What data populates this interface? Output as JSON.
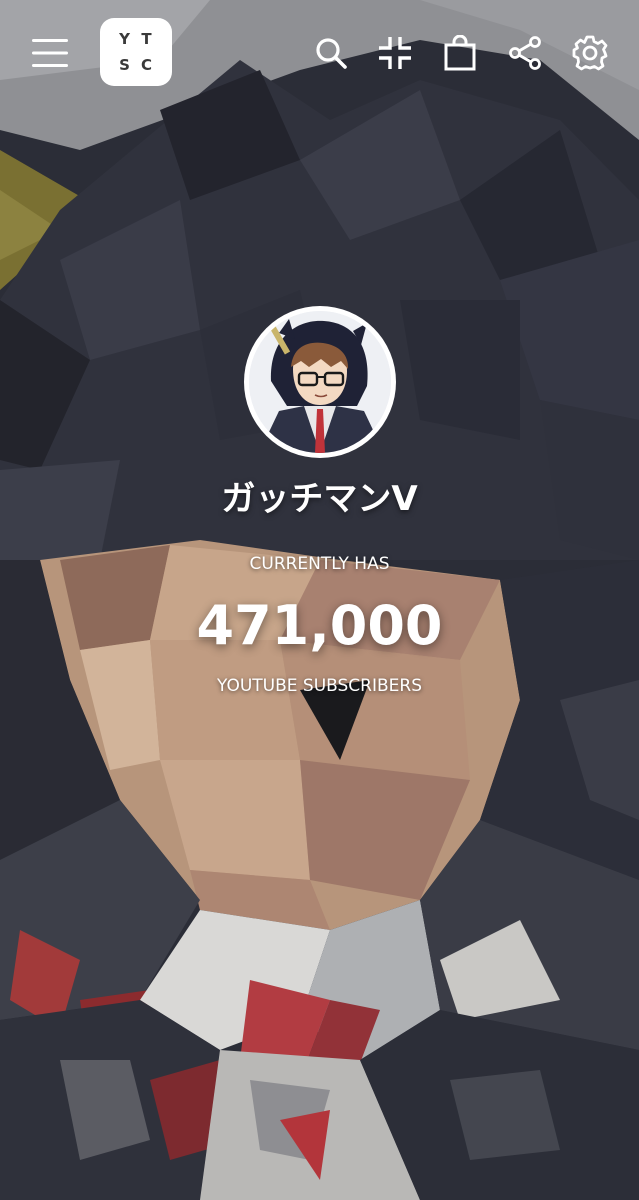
{
  "header": {
    "logo_letters": [
      "Y",
      "T",
      "S",
      "C"
    ],
    "icons": [
      "menu-icon",
      "search-icon",
      "compress-icon",
      "shopping-bag-icon",
      "share-icon",
      "settings-icon"
    ]
  },
  "channel": {
    "name": "ガッチマンV",
    "label_above": "CURRENTLY HAS",
    "subscriber_count": "471,000",
    "label_below": "YOUTUBE SUBSCRIBERS"
  },
  "colors": {
    "text": "#ffffff",
    "background": "#2a2c36",
    "logo_background": "#ffffff"
  }
}
